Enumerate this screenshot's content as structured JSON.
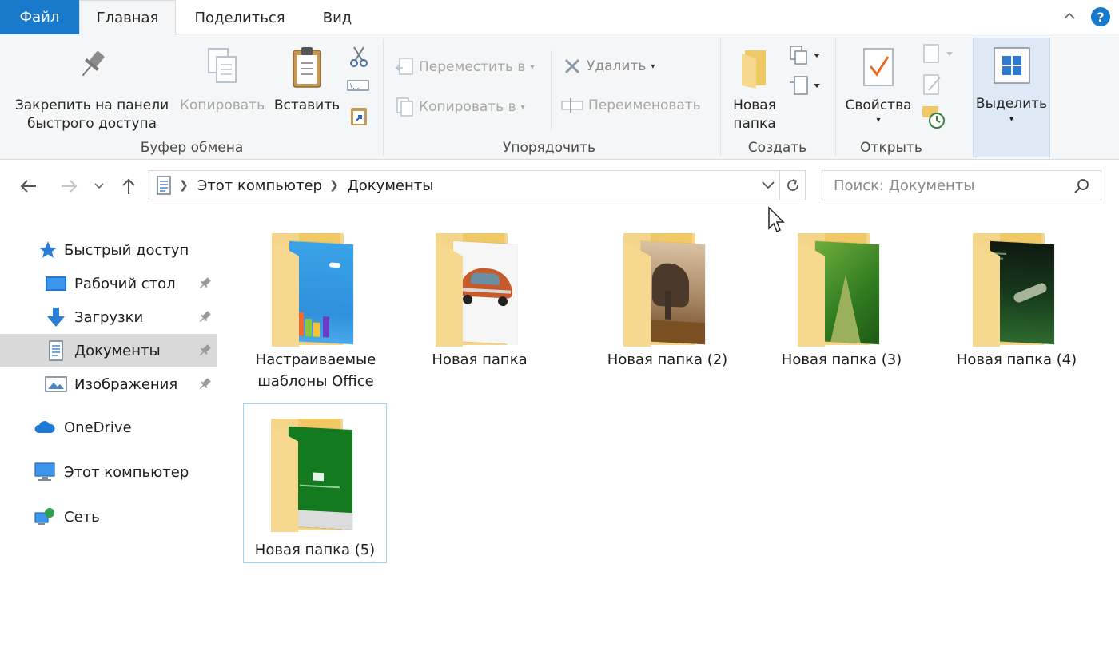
{
  "tabs": {
    "file": "Файл",
    "home": "Главная",
    "share": "Поделиться",
    "view": "Вид"
  },
  "help_label": "?",
  "ribbon": {
    "clipboard": {
      "pin": "Закрепить на панели быстрого доступа",
      "copy": "Копировать",
      "paste": "Вставить",
      "group": "Буфер обмена"
    },
    "organize": {
      "move_to": "Переместить в",
      "copy_to": "Копировать в",
      "delete": "Удалить",
      "rename": "Переименовать",
      "group": "Упорядочить"
    },
    "new": {
      "new_folder": "Новая папка",
      "group": "Создать"
    },
    "open": {
      "properties": "Свойства",
      "group": "Открыть"
    },
    "select": {
      "label": "Выделить"
    }
  },
  "address": {
    "crumbs": [
      "Этот компьютер",
      "Документы"
    ]
  },
  "search": {
    "placeholder": "Поиск: Документы"
  },
  "nav": {
    "quick_access": "Быстрый доступ",
    "desktop": "Рабочий стол",
    "downloads": "Загрузки",
    "documents": "Документы",
    "pictures": "Изображения",
    "onedrive": "OneDrive",
    "this_pc": "Этот компьютер",
    "network": "Сеть"
  },
  "folders": [
    {
      "name": "Настраиваемые шаблоны Office",
      "art": "office-template-art"
    },
    {
      "name": "Новая папка",
      "art": "car-photo"
    },
    {
      "name": "Новая папка (2)",
      "art": "elephant-photo"
    },
    {
      "name": "Новая папка (3)",
      "art": "leaf-photo"
    },
    {
      "name": "Новая папка (4)",
      "art": "lizard-photo"
    },
    {
      "name": "Новая папка (5)",
      "art": "green-document"
    }
  ],
  "colors": {
    "accent": "#1979ca",
    "folder": "#f4d58a",
    "selection": "#99d1ff"
  }
}
